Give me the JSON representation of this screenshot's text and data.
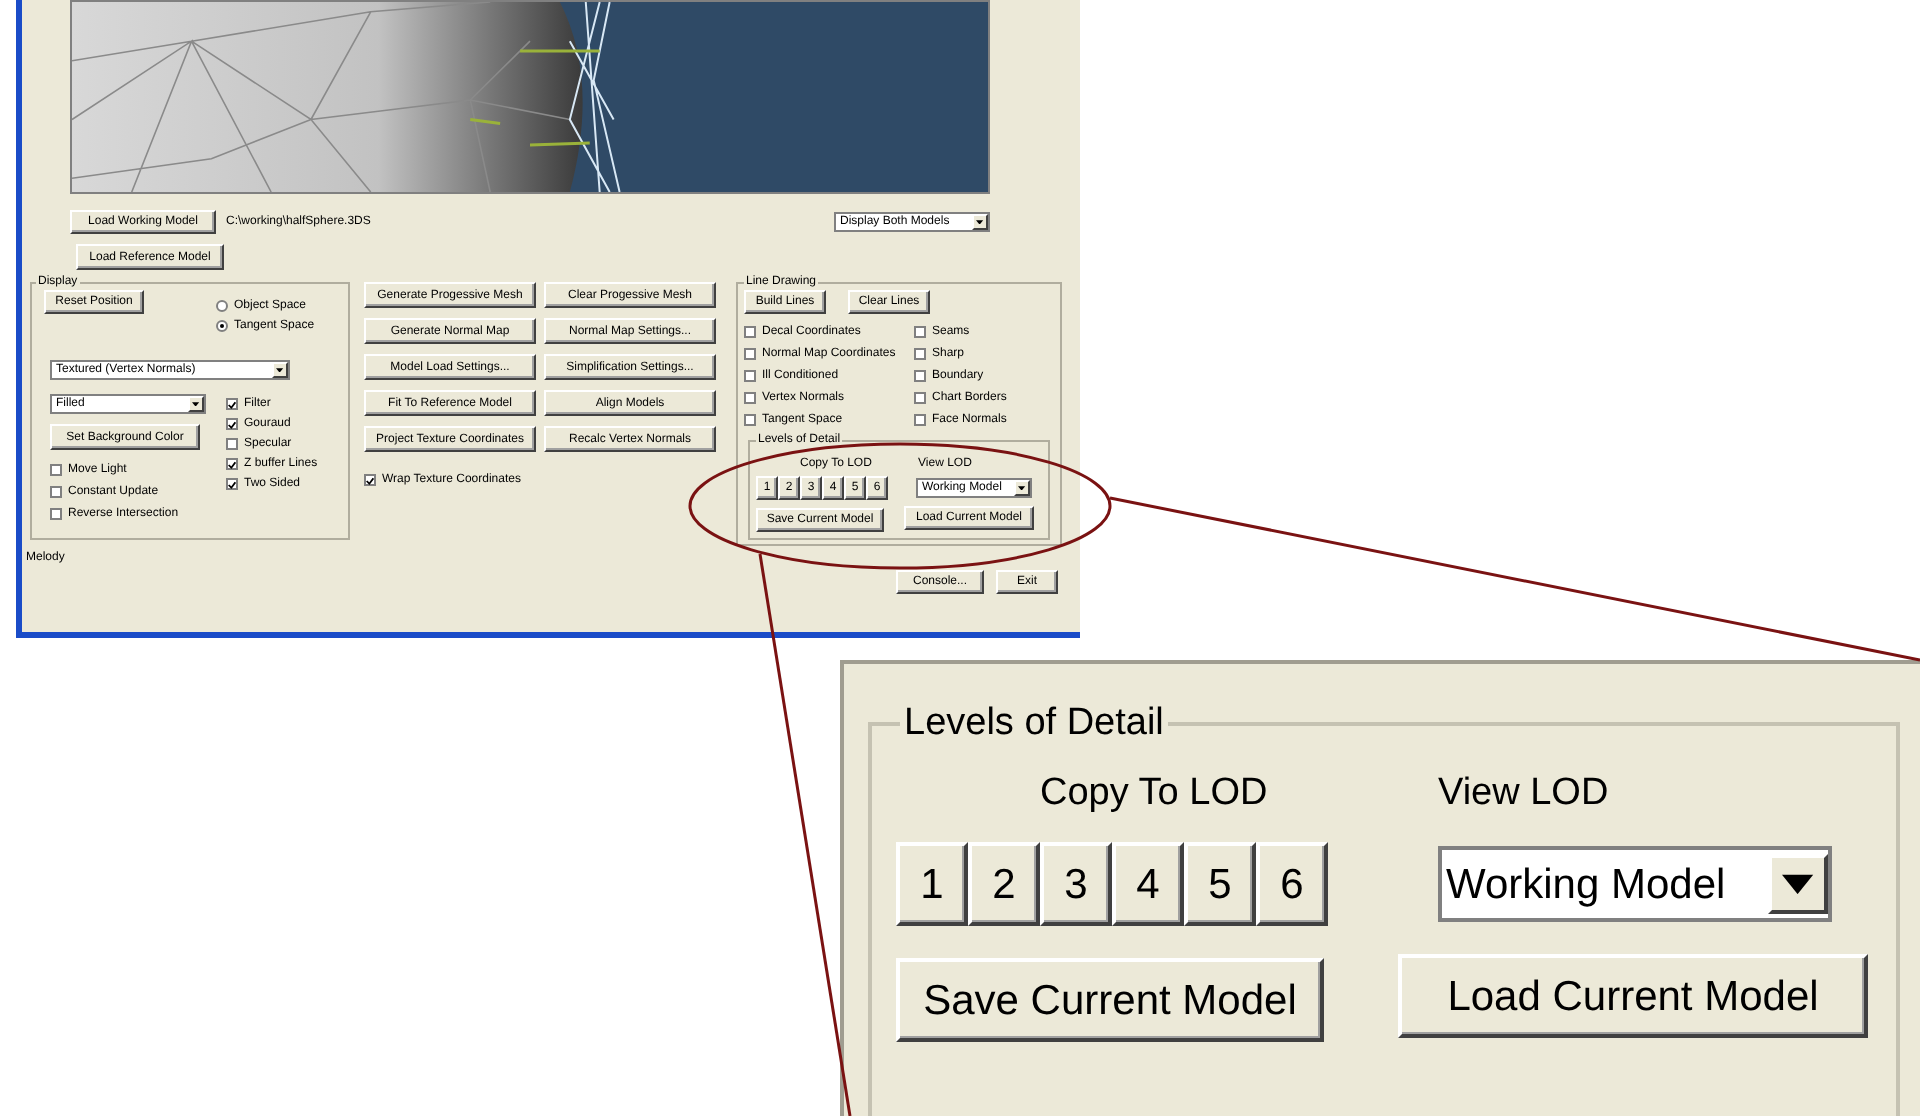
{
  "model_row": {
    "load_working": "Load Working Model",
    "path": "C:\\working\\halfSphere.3DS",
    "display_mode": "Display Both Models"
  },
  "load_reference": "Load Reference Model",
  "display": {
    "title": "Display",
    "reset": "Reset Position",
    "space_options": [
      {
        "label": "Object Space",
        "selected": false
      },
      {
        "label": "Tangent Space",
        "selected": true
      }
    ],
    "shading": "Textured (Vertex Normals)",
    "fill": "Filled",
    "background_button": "Set Background Color",
    "options_left": [
      {
        "label": "Move Light",
        "checked": false
      },
      {
        "label": "Constant Update",
        "checked": false
      },
      {
        "label": "Reverse Intersection",
        "checked": false
      }
    ],
    "options_right": [
      {
        "label": "Filter",
        "checked": true
      },
      {
        "label": "Gouraud",
        "checked": true
      },
      {
        "label": "Specular",
        "checked": false
      },
      {
        "label": "Z buffer Lines",
        "checked": true
      },
      {
        "label": "Two Sided",
        "checked": true
      }
    ]
  },
  "status": "Melody",
  "actions": [
    "Generate Progessive Mesh",
    "Clear Progessive Mesh",
    "Generate Normal Map",
    "Normal Map Settings...",
    "Model Load Settings...",
    "Simplification Settings...",
    "Fit To Reference Model",
    "Align Models",
    "Project Texture Coordinates",
    "Recalc Vertex Normals"
  ],
  "wrap": {
    "label": "Wrap Texture Coordinates",
    "checked": true
  },
  "line_drawing": {
    "title": "Line Drawing",
    "buttons": [
      "Build Lines",
      "Clear Lines"
    ],
    "options": [
      {
        "label": "Decal Coordinates",
        "checked": false
      },
      {
        "label": "Seams",
        "checked": false
      },
      {
        "label": "Normal Map Coordinates",
        "checked": false
      },
      {
        "label": "Sharp",
        "checked": false
      },
      {
        "label": "Ill Conditioned",
        "checked": false
      },
      {
        "label": "Boundary",
        "checked": false
      },
      {
        "label": "Vertex Normals",
        "checked": false
      },
      {
        "label": "Chart Borders",
        "checked": false
      },
      {
        "label": "Tangent Space",
        "checked": false
      },
      {
        "label": "Face Normals",
        "checked": false
      }
    ]
  },
  "lod": {
    "title": "Levels of Detail",
    "copy_label": "Copy To LOD",
    "slots": [
      "1",
      "2",
      "3",
      "4",
      "5",
      "6"
    ],
    "view_label": "View LOD",
    "view_value": "Working Model",
    "save": "Save Current Model",
    "load": "Load Current Model"
  },
  "footer_buttons": [
    "Console...",
    "Exit"
  ],
  "callout": {
    "title": "Levels of Detail",
    "copy_label": "Copy To LOD",
    "slots": [
      "1",
      "2",
      "3",
      "4",
      "5",
      "6"
    ],
    "view_label": "View LOD",
    "view_value": "Working Model",
    "save": "Save Current Model",
    "load": "Load Current Model"
  }
}
